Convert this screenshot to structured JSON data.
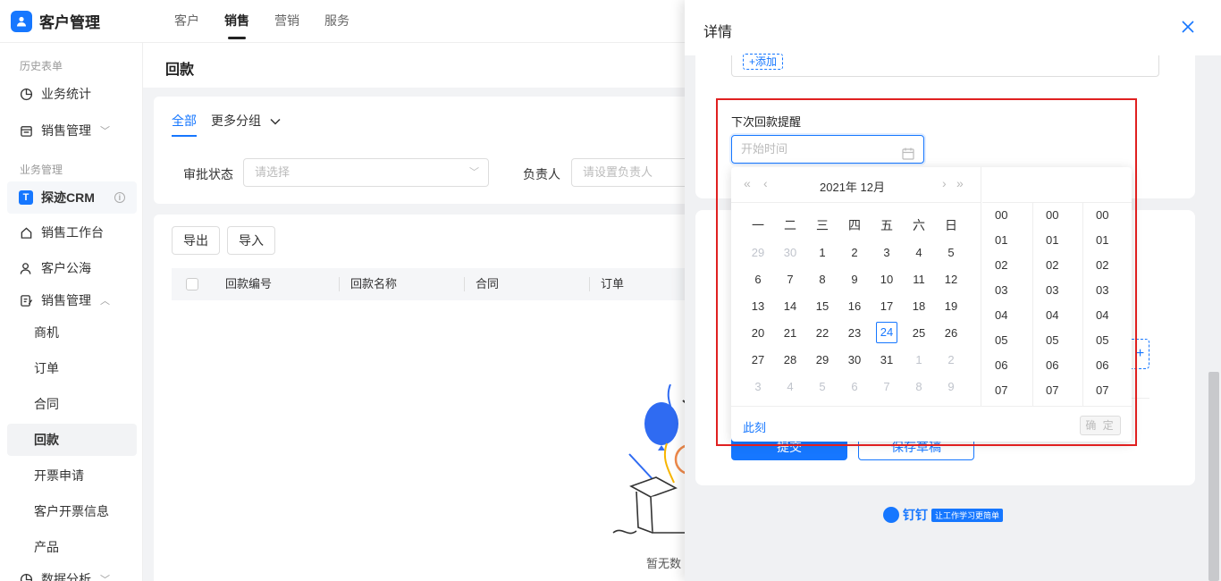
{
  "app": {
    "title": "客户管理"
  },
  "topnav": [
    "客户",
    "销售",
    "营销",
    "服务"
  ],
  "sidebar": {
    "group_history": "历史表单",
    "item_stats": "业务统计",
    "item_sales_mgmt1": "销售管理",
    "group_business": "业务管理",
    "crm_badge": "T",
    "item_crm": "探迹CRM",
    "item_workbench": "销售工作台",
    "item_pool": "客户公海",
    "item_sales_mgmt2": "销售管理",
    "sub_items": [
      "商机",
      "订单",
      "合同",
      "回款",
      "开票申请",
      "客户开票信息",
      "产品"
    ],
    "item_analysis": "数据分析"
  },
  "page": {
    "title": "回款",
    "tab_all": "全部",
    "tab_more": "更多分组",
    "approval_label": "审批状态",
    "approval_placeholder": "请选择",
    "owner_label": "负责人",
    "owner_placeholder": "请设置负责人",
    "export_btn": "导出",
    "import_btn": "导入",
    "columns": [
      "回款编号",
      "回款名称",
      "合同",
      "订单"
    ],
    "empty_text": "暂无数"
  },
  "drawer": {
    "title": "详情",
    "add_link": "+添加",
    "field_label": "下次回款提醒",
    "date_placeholder": "开始时间",
    "submit_btn": "提交",
    "save_draft_btn": "保存草稿",
    "dingtalk_name": "钉钉",
    "dingtalk_slogan": "让工作学习更简单"
  },
  "datepicker": {
    "title": "2021年  12月",
    "weekdays": [
      "一",
      "二",
      "三",
      "四",
      "五",
      "六",
      "日"
    ],
    "days": [
      {
        "d": "29",
        "o": true
      },
      {
        "d": "30",
        "o": true
      },
      {
        "d": "1"
      },
      {
        "d": "2"
      },
      {
        "d": "3"
      },
      {
        "d": "4"
      },
      {
        "d": "5"
      },
      {
        "d": "6"
      },
      {
        "d": "7"
      },
      {
        "d": "8"
      },
      {
        "d": "9"
      },
      {
        "d": "10"
      },
      {
        "d": "11"
      },
      {
        "d": "12"
      },
      {
        "d": "13"
      },
      {
        "d": "14"
      },
      {
        "d": "15"
      },
      {
        "d": "16"
      },
      {
        "d": "17"
      },
      {
        "d": "18"
      },
      {
        "d": "19"
      },
      {
        "d": "20"
      },
      {
        "d": "21"
      },
      {
        "d": "22"
      },
      {
        "d": "23"
      },
      {
        "d": "24",
        "today": true
      },
      {
        "d": "25"
      },
      {
        "d": "26"
      },
      {
        "d": "27"
      },
      {
        "d": "28"
      },
      {
        "d": "29"
      },
      {
        "d": "30"
      },
      {
        "d": "31"
      },
      {
        "d": "1",
        "o": true
      },
      {
        "d": "2",
        "o": true
      },
      {
        "d": "3",
        "o": true
      },
      {
        "d": "4",
        "o": true
      },
      {
        "d": "5",
        "o": true
      },
      {
        "d": "6",
        "o": true
      },
      {
        "d": "7",
        "o": true
      },
      {
        "d": "8",
        "o": true
      },
      {
        "d": "9",
        "o": true
      }
    ],
    "hours": [
      "00",
      "01",
      "02",
      "03",
      "04",
      "05",
      "06",
      "07"
    ],
    "minutes": [
      "00",
      "01",
      "02",
      "03",
      "04",
      "05",
      "06",
      "07"
    ],
    "seconds": [
      "00",
      "01",
      "02",
      "03",
      "04",
      "05",
      "06",
      "07"
    ],
    "now_label": "此刻",
    "ok_label": "确 定"
  },
  "colors": {
    "accent": "#1677ff",
    "highlight": "#e02020"
  }
}
